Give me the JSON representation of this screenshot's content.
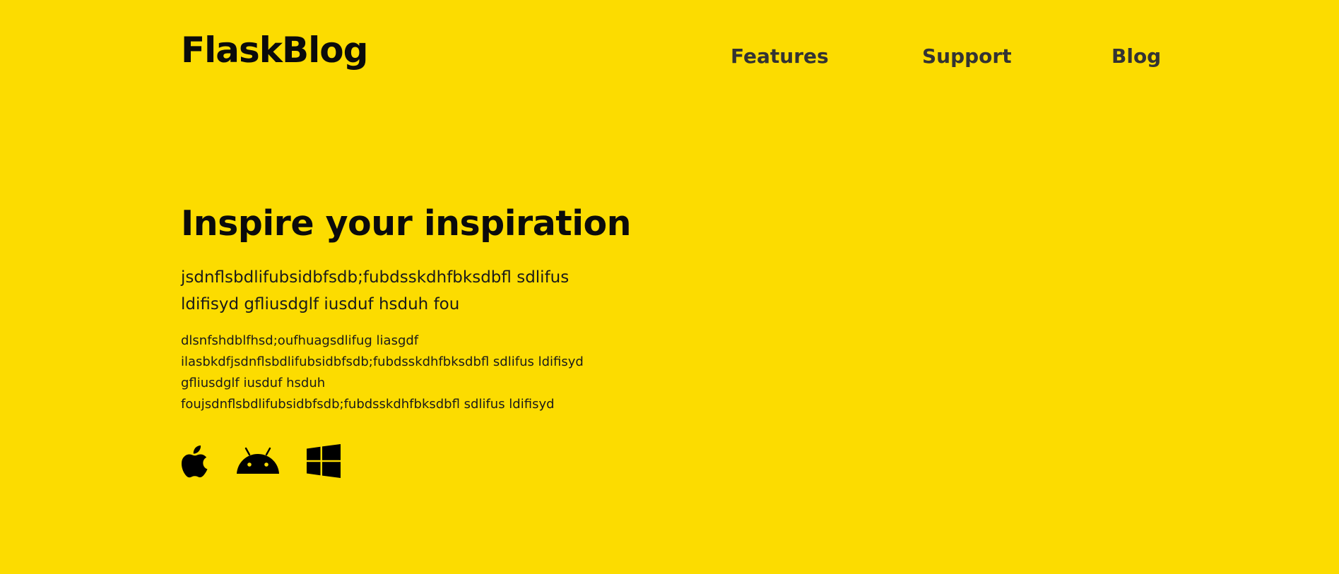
{
  "header": {
    "brand": "FlaskBlog",
    "nav": [
      {
        "label": "Features"
      },
      {
        "label": "Support"
      },
      {
        "label": "Blog"
      }
    ]
  },
  "hero": {
    "title": "Inspire your inspiration",
    "lead": "jsdnflsbdlifubsidbfsdb;fubdsskdhfbksdbfl sdlifus ldifisyd gfliusdglf iusduf hsduh fou",
    "body": "dlsnfshdblfhsd;oufhuagsdlifug liasgdf ilasbkdfjsdnflsbdlifubsidbfsdb;fubdsskdhfbksdbfl sdlifus ldifisyd gfliusdglf iusduf hsduh foujsdnflsbdlifubsidbfsdb;fubdsskdhfbksdbfl sdlifus ldifisyd"
  },
  "platforms": [
    {
      "icon": "apple-icon"
    },
    {
      "icon": "android-icon"
    },
    {
      "icon": "windows-icon"
    }
  ],
  "colors": {
    "background": "#fcdc00",
    "text": "#0b0b0b",
    "nav": "#333333"
  }
}
